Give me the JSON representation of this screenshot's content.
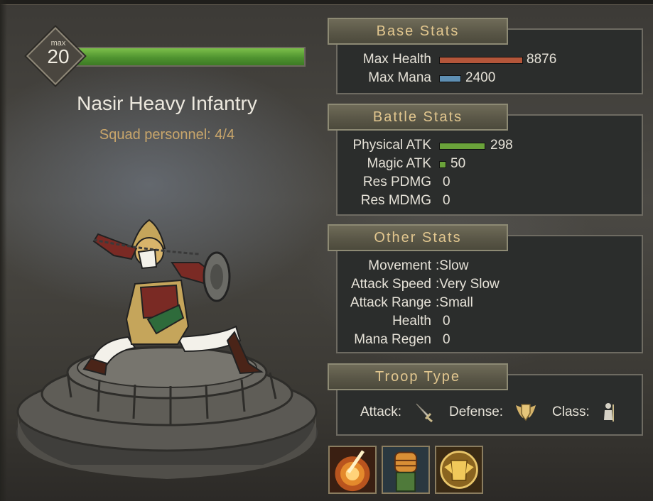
{
  "level": {
    "max_label": "max",
    "value": "20",
    "bar_fill_fraction": 1.0
  },
  "unit": {
    "name": "Nasir Heavy Infantry",
    "squad": "Squad personnel: 4/4"
  },
  "base_stats": {
    "title": "Base Stats",
    "rows": [
      {
        "label": "Max Health",
        "value": "8876",
        "bar_fraction": 1.0,
        "color": "#b4563a"
      },
      {
        "label": "Max Mana",
        "value": "2400",
        "bar_fraction": 0.25,
        "color": "#5e8fb3"
      }
    ]
  },
  "battle_stats": {
    "title": "Battle Stats",
    "rows": [
      {
        "label": "Physical ATK",
        "value": "298",
        "bar_fraction": 1.0,
        "color": "#6aa23a"
      },
      {
        "label": "Magic ATK",
        "value": "50",
        "bar_fraction": 0.12,
        "color": "#6aa23a"
      },
      {
        "label": "Res PDMG",
        "value": "0"
      },
      {
        "label": "Res MDMG",
        "value": "0"
      }
    ]
  },
  "other_stats": {
    "title": "Other Stats",
    "rows": [
      {
        "label": "Movement",
        "value": ":Slow"
      },
      {
        "label": "Attack Speed",
        "value": ":Very Slow"
      },
      {
        "label": "Attack Range",
        "value": ":Small"
      },
      {
        "label": "Health",
        "value": "0"
      },
      {
        "label": "Mana Regen",
        "value": "0"
      }
    ]
  },
  "troop_type": {
    "title": "Troop Type",
    "attack_label": "Attack:",
    "attack_icon": "sword-icon",
    "defense_label": "Defense:",
    "defense_icon": "winged-shield-icon",
    "class_label": "Class:",
    "class_icon": "infantry-icon"
  },
  "skills": [
    "blade-strike-skill-icon",
    "clenched-fist-skill-icon",
    "golden-armor-skill-icon"
  ],
  "colors": {
    "accent_gold": "#e2c78f",
    "squad_text": "#c9a66b",
    "level_bar": "#4f9330"
  }
}
